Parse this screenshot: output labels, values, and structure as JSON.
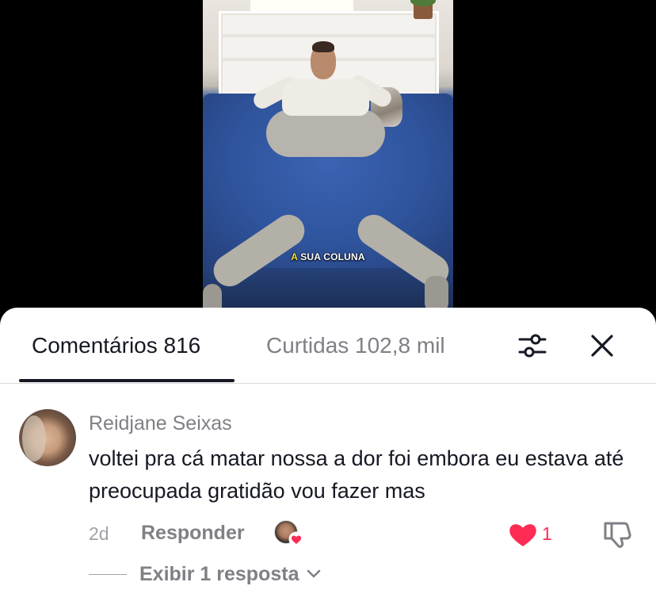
{
  "video": {
    "caption_highlight": "A",
    "caption_rest": " SUA COLUNA"
  },
  "sheet": {
    "tabs": [
      {
        "label": "Comentários 816",
        "active": true
      },
      {
        "label": "Curtidas 102,8 mil",
        "active": false
      }
    ],
    "icons": {
      "filter": "filter-sliders-icon",
      "close": "close-icon"
    }
  },
  "comment": {
    "author": "Reidjane Seixas",
    "text": "voltei pra cá matar nossa a dor foi embora eu estava até preocupada gratidão vou fazer mas",
    "time": "2d",
    "reply_label": "Responder",
    "like_count": "1",
    "view_replies_label": "Exibir 1 resposta",
    "icons": {
      "like": "heart-icon",
      "dislike": "thumbs-down-icon",
      "creator_liked": "creator-liked-icon",
      "chevron": "chevron-down-icon"
    }
  },
  "colors": {
    "accent_red": "#fe2c55",
    "text_primary": "#161823",
    "text_secondary": "#7f7f86",
    "caption_highlight": "#f2e23c"
  }
}
